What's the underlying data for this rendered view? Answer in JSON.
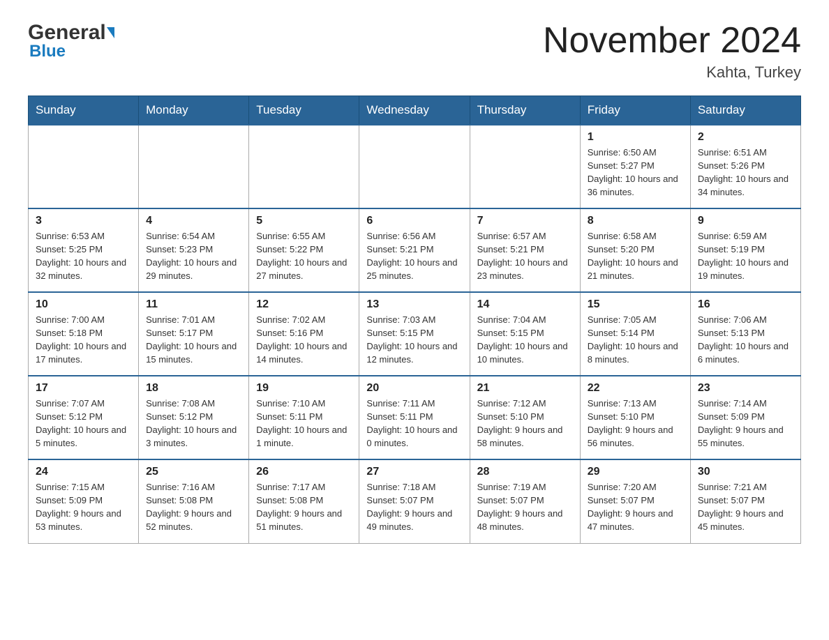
{
  "logo": {
    "general": "General",
    "triangle": "▼",
    "blue": "Blue"
  },
  "title": "November 2024",
  "subtitle": "Kahta, Turkey",
  "weekdays": [
    "Sunday",
    "Monday",
    "Tuesday",
    "Wednesday",
    "Thursday",
    "Friday",
    "Saturday"
  ],
  "weeks": [
    [
      {
        "day": "",
        "sunrise": "",
        "sunset": "",
        "daylight": ""
      },
      {
        "day": "",
        "sunrise": "",
        "sunset": "",
        "daylight": ""
      },
      {
        "day": "",
        "sunrise": "",
        "sunset": "",
        "daylight": ""
      },
      {
        "day": "",
        "sunrise": "",
        "sunset": "",
        "daylight": ""
      },
      {
        "day": "",
        "sunrise": "",
        "sunset": "",
        "daylight": ""
      },
      {
        "day": "1",
        "sunrise": "Sunrise: 6:50 AM",
        "sunset": "Sunset: 5:27 PM",
        "daylight": "Daylight: 10 hours and 36 minutes."
      },
      {
        "day": "2",
        "sunrise": "Sunrise: 6:51 AM",
        "sunset": "Sunset: 5:26 PM",
        "daylight": "Daylight: 10 hours and 34 minutes."
      }
    ],
    [
      {
        "day": "3",
        "sunrise": "Sunrise: 6:53 AM",
        "sunset": "Sunset: 5:25 PM",
        "daylight": "Daylight: 10 hours and 32 minutes."
      },
      {
        "day": "4",
        "sunrise": "Sunrise: 6:54 AM",
        "sunset": "Sunset: 5:23 PM",
        "daylight": "Daylight: 10 hours and 29 minutes."
      },
      {
        "day": "5",
        "sunrise": "Sunrise: 6:55 AM",
        "sunset": "Sunset: 5:22 PM",
        "daylight": "Daylight: 10 hours and 27 minutes."
      },
      {
        "day": "6",
        "sunrise": "Sunrise: 6:56 AM",
        "sunset": "Sunset: 5:21 PM",
        "daylight": "Daylight: 10 hours and 25 minutes."
      },
      {
        "day": "7",
        "sunrise": "Sunrise: 6:57 AM",
        "sunset": "Sunset: 5:21 PM",
        "daylight": "Daylight: 10 hours and 23 minutes."
      },
      {
        "day": "8",
        "sunrise": "Sunrise: 6:58 AM",
        "sunset": "Sunset: 5:20 PM",
        "daylight": "Daylight: 10 hours and 21 minutes."
      },
      {
        "day": "9",
        "sunrise": "Sunrise: 6:59 AM",
        "sunset": "Sunset: 5:19 PM",
        "daylight": "Daylight: 10 hours and 19 minutes."
      }
    ],
    [
      {
        "day": "10",
        "sunrise": "Sunrise: 7:00 AM",
        "sunset": "Sunset: 5:18 PM",
        "daylight": "Daylight: 10 hours and 17 minutes."
      },
      {
        "day": "11",
        "sunrise": "Sunrise: 7:01 AM",
        "sunset": "Sunset: 5:17 PM",
        "daylight": "Daylight: 10 hours and 15 minutes."
      },
      {
        "day": "12",
        "sunrise": "Sunrise: 7:02 AM",
        "sunset": "Sunset: 5:16 PM",
        "daylight": "Daylight: 10 hours and 14 minutes."
      },
      {
        "day": "13",
        "sunrise": "Sunrise: 7:03 AM",
        "sunset": "Sunset: 5:15 PM",
        "daylight": "Daylight: 10 hours and 12 minutes."
      },
      {
        "day": "14",
        "sunrise": "Sunrise: 7:04 AM",
        "sunset": "Sunset: 5:15 PM",
        "daylight": "Daylight: 10 hours and 10 minutes."
      },
      {
        "day": "15",
        "sunrise": "Sunrise: 7:05 AM",
        "sunset": "Sunset: 5:14 PM",
        "daylight": "Daylight: 10 hours and 8 minutes."
      },
      {
        "day": "16",
        "sunrise": "Sunrise: 7:06 AM",
        "sunset": "Sunset: 5:13 PM",
        "daylight": "Daylight: 10 hours and 6 minutes."
      }
    ],
    [
      {
        "day": "17",
        "sunrise": "Sunrise: 7:07 AM",
        "sunset": "Sunset: 5:12 PM",
        "daylight": "Daylight: 10 hours and 5 minutes."
      },
      {
        "day": "18",
        "sunrise": "Sunrise: 7:08 AM",
        "sunset": "Sunset: 5:12 PM",
        "daylight": "Daylight: 10 hours and 3 minutes."
      },
      {
        "day": "19",
        "sunrise": "Sunrise: 7:10 AM",
        "sunset": "Sunset: 5:11 PM",
        "daylight": "Daylight: 10 hours and 1 minute."
      },
      {
        "day": "20",
        "sunrise": "Sunrise: 7:11 AM",
        "sunset": "Sunset: 5:11 PM",
        "daylight": "Daylight: 10 hours and 0 minutes."
      },
      {
        "day": "21",
        "sunrise": "Sunrise: 7:12 AM",
        "sunset": "Sunset: 5:10 PM",
        "daylight": "Daylight: 9 hours and 58 minutes."
      },
      {
        "day": "22",
        "sunrise": "Sunrise: 7:13 AM",
        "sunset": "Sunset: 5:10 PM",
        "daylight": "Daylight: 9 hours and 56 minutes."
      },
      {
        "day": "23",
        "sunrise": "Sunrise: 7:14 AM",
        "sunset": "Sunset: 5:09 PM",
        "daylight": "Daylight: 9 hours and 55 minutes."
      }
    ],
    [
      {
        "day": "24",
        "sunrise": "Sunrise: 7:15 AM",
        "sunset": "Sunset: 5:09 PM",
        "daylight": "Daylight: 9 hours and 53 minutes."
      },
      {
        "day": "25",
        "sunrise": "Sunrise: 7:16 AM",
        "sunset": "Sunset: 5:08 PM",
        "daylight": "Daylight: 9 hours and 52 minutes."
      },
      {
        "day": "26",
        "sunrise": "Sunrise: 7:17 AM",
        "sunset": "Sunset: 5:08 PM",
        "daylight": "Daylight: 9 hours and 51 minutes."
      },
      {
        "day": "27",
        "sunrise": "Sunrise: 7:18 AM",
        "sunset": "Sunset: 5:07 PM",
        "daylight": "Daylight: 9 hours and 49 minutes."
      },
      {
        "day": "28",
        "sunrise": "Sunrise: 7:19 AM",
        "sunset": "Sunset: 5:07 PM",
        "daylight": "Daylight: 9 hours and 48 minutes."
      },
      {
        "day": "29",
        "sunrise": "Sunrise: 7:20 AM",
        "sunset": "Sunset: 5:07 PM",
        "daylight": "Daylight: 9 hours and 47 minutes."
      },
      {
        "day": "30",
        "sunrise": "Sunrise: 7:21 AM",
        "sunset": "Sunset: 5:07 PM",
        "daylight": "Daylight: 9 hours and 45 minutes."
      }
    ]
  ]
}
